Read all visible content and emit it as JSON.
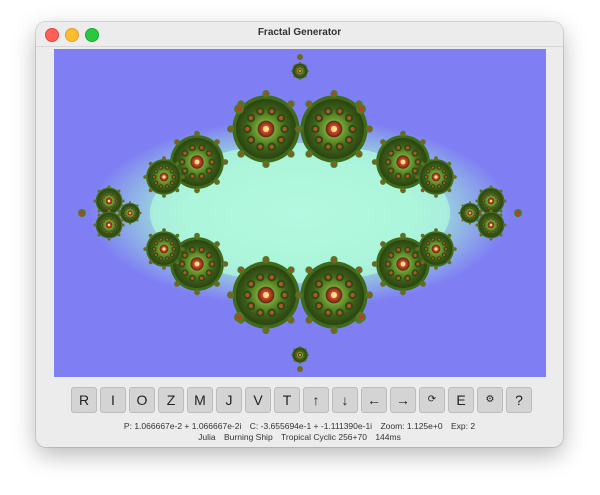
{
  "window": {
    "title": "Fractal Generator"
  },
  "toolbar": {
    "buttons": [
      {
        "id": "r",
        "label": "R"
      },
      {
        "id": "i",
        "label": "I"
      },
      {
        "id": "o",
        "label": "O"
      },
      {
        "id": "z",
        "label": "Z"
      },
      {
        "id": "m",
        "label": "M"
      },
      {
        "id": "j",
        "label": "J"
      },
      {
        "id": "v",
        "label": "V"
      },
      {
        "id": "t",
        "label": "T"
      },
      {
        "id": "up",
        "label": "↑"
      },
      {
        "id": "down",
        "label": "↓"
      },
      {
        "id": "left",
        "label": "←"
      },
      {
        "id": "right",
        "label": "→"
      },
      {
        "id": "cycle",
        "label": "⟳"
      },
      {
        "id": "e",
        "label": "E"
      },
      {
        "id": "settings",
        "label": "⚙"
      },
      {
        "id": "help",
        "label": "?"
      }
    ]
  },
  "status": {
    "p": "P: 1.066667e-2 + 1.066667e-2i",
    "c": "C: -3.655694e-1 + -1.111390e-1i",
    "zoom": "Zoom: 1.125e+0",
    "exp": "Exp: 2",
    "mode": "Julia",
    "fractal": "Burning Ship",
    "palette": "Tropical Cyclic 256+70",
    "time": "144ms"
  },
  "colors": {
    "background": "#7f7ff3",
    "interior_glow": "#a8f5d8",
    "bulb_green": "#6a9a2e",
    "bulb_dark": "#2e4a14",
    "spiral_red": "#c0392b"
  }
}
